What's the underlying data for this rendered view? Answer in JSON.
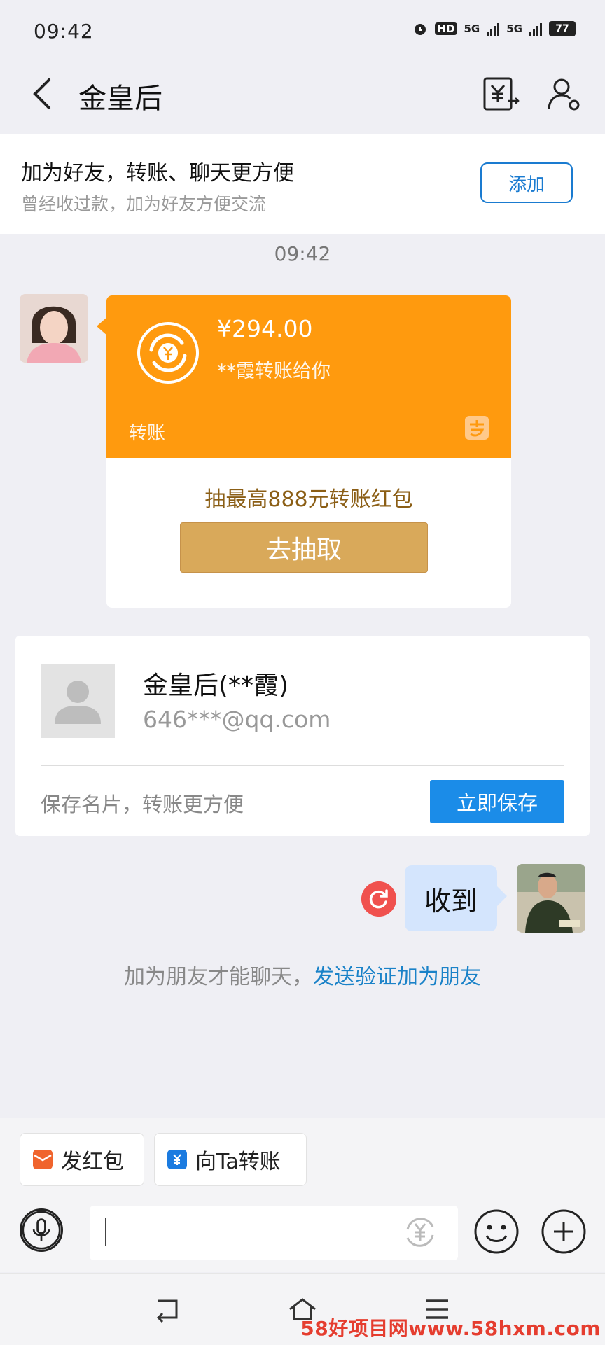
{
  "status_bar": {
    "time": "09:42",
    "battery": "77",
    "network_1": "5G",
    "network_2": "5G",
    "hd": "HD"
  },
  "header": {
    "title": "金皇后"
  },
  "banner": {
    "title": "加为好友，转账、聊天更方便",
    "subtitle": "曾经收过款，加为好友方便交流",
    "add_label": "添加"
  },
  "chat": {
    "timestamp": "09:42",
    "transfer": {
      "amount": "¥294.00",
      "from_text": "**霞转账给你",
      "label": "转账",
      "lottery_text": "抽最高888元转账红包",
      "draw_button": "去抽取"
    },
    "contact_card": {
      "name": "金皇后(**霞)",
      "email": "646***@qq.com",
      "tip": "保存名片，转账更方便",
      "save_button": "立即保存"
    },
    "sent_message": "收到",
    "hint_prefix": "加为朋友才能聊天，",
    "hint_link": "发送验证加为朋友"
  },
  "toolbar": {
    "red_packet_label": "发红包",
    "transfer_label": "向Ta转账",
    "input_value": ""
  },
  "watermark": "58好项目网www.58hxm.com",
  "colors": {
    "transfer_orange": "#ff9a0e",
    "save_blue": "#1b8ce8",
    "link_blue": "#1a82c8",
    "bubble_blue": "#d4e5fd",
    "draw_gold": "#d9a95a"
  }
}
